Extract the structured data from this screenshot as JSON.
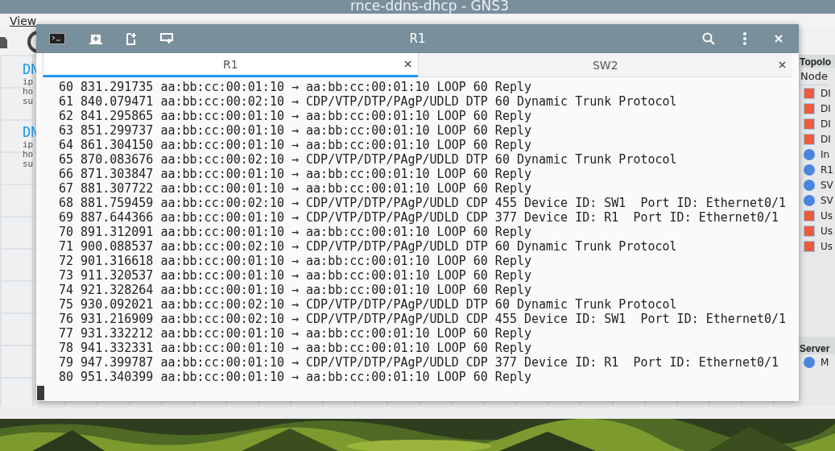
{
  "app_window": {
    "title": "rnce-ddns-dhcp - GNS3",
    "menu": [
      "View"
    ],
    "canvas_labels": [
      {
        "heading": "DN",
        "lines": [
          "ip",
          "ho",
          "su"
        ]
      },
      {
        "heading": "DN",
        "lines": [
          "ip",
          "ho",
          "su"
        ]
      }
    ],
    "topology": {
      "title": "Topolo",
      "column": "Node",
      "nodes": [
        {
          "label": "DI",
          "kind": "square"
        },
        {
          "label": "DI",
          "kind": "square"
        },
        {
          "label": "DI",
          "kind": "square"
        },
        {
          "label": "DI",
          "kind": "square"
        },
        {
          "label": "In",
          "kind": "circle"
        },
        {
          "label": "R1",
          "kind": "circle"
        },
        {
          "label": "SV",
          "kind": "circle"
        },
        {
          "label": "SV",
          "kind": "circle"
        },
        {
          "label": "Us",
          "kind": "square"
        },
        {
          "label": "Us",
          "kind": "square"
        },
        {
          "label": "Us",
          "kind": "square"
        }
      ]
    },
    "servers": {
      "title": "Server",
      "items": [
        {
          "label": "M",
          "kind": "circle"
        }
      ]
    }
  },
  "terminal": {
    "title": "R1",
    "tabs": [
      {
        "label": "R1",
        "selected": true
      },
      {
        "label": "SW2",
        "selected": false
      }
    ],
    "lines": [
      "60 831.291735 aa:bb:cc:00:01:10 → aa:bb:cc:00:01:10 LOOP 60 Reply",
      "61 840.079471 aa:bb:cc:00:02:10 → CDP/VTP/DTP/PAgP/UDLD DTP 60 Dynamic Trunk Protocol",
      "62 841.295865 aa:bb:cc:00:01:10 → aa:bb:cc:00:01:10 LOOP 60 Reply",
      "63 851.299737 aa:bb:cc:00:01:10 → aa:bb:cc:00:01:10 LOOP 60 Reply",
      "64 861.304150 aa:bb:cc:00:01:10 → aa:bb:cc:00:01:10 LOOP 60 Reply",
      "65 870.083676 aa:bb:cc:00:02:10 → CDP/VTP/DTP/PAgP/UDLD DTP 60 Dynamic Trunk Protocol",
      "66 871.303847 aa:bb:cc:00:01:10 → aa:bb:cc:00:01:10 LOOP 60 Reply",
      "67 881.307722 aa:bb:cc:00:01:10 → aa:bb:cc:00:01:10 LOOP 60 Reply",
      "68 881.759459 aa:bb:cc:00:02:10 → CDP/VTP/DTP/PAgP/UDLD CDP 455 Device ID: SW1  Port ID: Ethernet0/1",
      "69 887.644366 aa:bb:cc:00:01:10 → CDP/VTP/DTP/PAgP/UDLD CDP 377 Device ID: R1  Port ID: Ethernet0/1",
      "70 891.312091 aa:bb:cc:00:01:10 → aa:bb:cc:00:01:10 LOOP 60 Reply",
      "71 900.088537 aa:bb:cc:00:02:10 → CDP/VTP/DTP/PAgP/UDLD DTP 60 Dynamic Trunk Protocol",
      "72 901.316618 aa:bb:cc:00:01:10 → aa:bb:cc:00:01:10 LOOP 60 Reply",
      "73 911.320537 aa:bb:cc:00:01:10 → aa:bb:cc:00:01:10 LOOP 60 Reply",
      "74 921.328264 aa:bb:cc:00:01:10 → aa:bb:cc:00:01:10 LOOP 60 Reply",
      "75 930.092021 aa:bb:cc:00:02:10 → CDP/VTP/DTP/PAgP/UDLD DTP 60 Dynamic Trunk Protocol",
      "76 931.216909 aa:bb:cc:00:02:10 → CDP/VTP/DTP/PAgP/UDLD CDP 455 Device ID: SW1  Port ID: Ethernet0/1",
      "77 931.332212 aa:bb:cc:00:01:10 → aa:bb:cc:00:01:10 LOOP 60 Reply",
      "78 941.332331 aa:bb:cc:00:01:10 → aa:bb:cc:00:01:10 LOOP 60 Reply",
      "79 947.399787 aa:bb:cc:00:01:10 → CDP/VTP/DTP/PAgP/UDLD CDP 377 Device ID: R1  Port ID: Ethernet0/1",
      "80 951.340399 aa:bb:cc:00:01:10 → aa:bb:cc:00:01:10 LOOP 60 Reply"
    ]
  }
}
